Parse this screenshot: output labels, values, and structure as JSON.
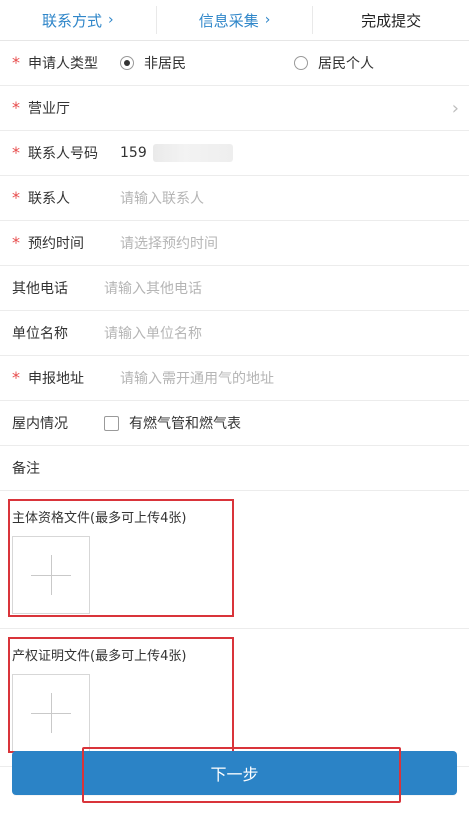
{
  "steps": [
    {
      "label": "联系方式",
      "chevron": "›",
      "active": false
    },
    {
      "label": "信息采集",
      "chevron": "›",
      "active": false
    },
    {
      "label": "完成提交",
      "active": true
    }
  ],
  "form": {
    "required_mark": "*",
    "rows": [
      {
        "label": "申请人类型",
        "required": true,
        "type": "radio",
        "options": [
          "非居民",
          "居民个人"
        ],
        "selected_index": 0
      },
      {
        "label": "营业厅",
        "required": true,
        "type": "select",
        "chevron": "›"
      },
      {
        "label": "联系人号码",
        "required": true,
        "type": "text",
        "value_prefix": "159",
        "masked": true
      },
      {
        "label": "联系人",
        "required": true,
        "type": "input",
        "placeholder": "请输入联系人"
      },
      {
        "label": "预约时间",
        "required": true,
        "type": "input",
        "placeholder": "请选择预约时间"
      },
      {
        "label": "其他电话",
        "required": false,
        "type": "input",
        "placeholder": "请输入其他电话"
      },
      {
        "label": "单位名称",
        "required": false,
        "type": "input",
        "placeholder": "请输入单位名称"
      },
      {
        "label": "申报地址",
        "required": true,
        "type": "input",
        "placeholder": "请输入需开通用气的地址"
      },
      {
        "label": "屋内情况",
        "required": false,
        "type": "checkbox",
        "checkbox_label": "有燃气管和燃气表",
        "checked": false
      },
      {
        "label": "备注",
        "required": false,
        "type": "text",
        "value": ""
      }
    ]
  },
  "uploads": [
    {
      "title": "主体资格文件(最多可上传4张)"
    },
    {
      "title": "产权证明文件(最多可上传4张)"
    }
  ],
  "buttons": {
    "next_label": "下一步"
  },
  "colors": {
    "accent_blue": "#2f86c9",
    "button_blue": "#2b83c6",
    "required_red": "#e74a4a",
    "highlight_red": "#d9343a"
  },
  "icons": {
    "chevron_right": "chevron-right-icon",
    "plus": "plus-icon",
    "radio_checked": "radio-checked-icon",
    "radio_unchecked": "radio-unchecked-icon",
    "checkbox_unchecked": "checkbox-unchecked-icon"
  }
}
